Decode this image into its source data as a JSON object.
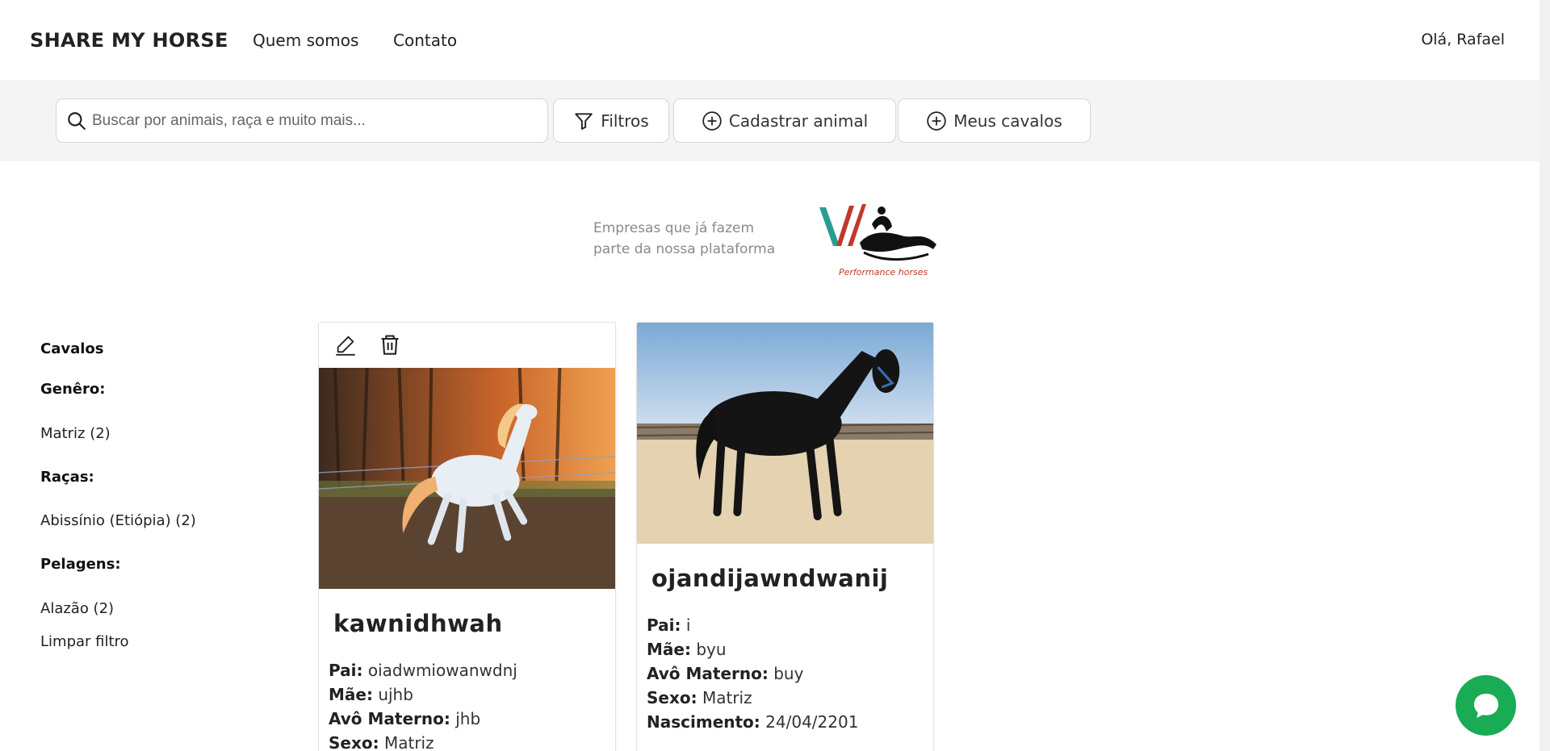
{
  "header": {
    "brand": "SHARE MY HORSE",
    "nav": [
      "Quem somos",
      "Contato"
    ],
    "greeting": "Olá, Rafael"
  },
  "toolbar": {
    "search_placeholder": "Buscar por animais, raça e muito mais...",
    "filters_label": "Filtros",
    "register_label": "Cadastrar animal",
    "my_horses_label": "Meus cavalos"
  },
  "partners": {
    "text_line1": "Empresas que já fazem",
    "text_line2": "parte da nossa plataforma",
    "logo_caption": "Performance horses"
  },
  "sidebar": {
    "title": "Cavalos",
    "gender_heading": "Genêro:",
    "gender_item": "Matriz (2)",
    "breeds_heading": "Raças:",
    "breeds_item": "Abissínio (Etiópia) (2)",
    "coats_heading": "Pelagens:",
    "coats_item": "Alazão (2)",
    "clear_filter": "Limpar filtro"
  },
  "cards": [
    {
      "name": "kawnidhwah",
      "fields": [
        {
          "label": "Pai:",
          "value": "oiadwmiowanwdnj"
        },
        {
          "label": "Mãe:",
          "value": "ujhb"
        },
        {
          "label": "Avô Materno:",
          "value": "jhb"
        },
        {
          "label": "Sexo:",
          "value": "Matriz"
        }
      ]
    },
    {
      "name": "ojandijawndwanij",
      "fields": [
        {
          "label": "Pai:",
          "value": "i"
        },
        {
          "label": "Mãe:",
          "value": "byu"
        },
        {
          "label": "Avô Materno:",
          "value": "buy"
        },
        {
          "label": "Sexo:",
          "value": "Matriz"
        },
        {
          "label": "Nascimento:",
          "value": "24/04/2201"
        }
      ]
    }
  ],
  "colors": {
    "chat": "#1aab55",
    "toolbar_bg": "#f4f4f4"
  }
}
